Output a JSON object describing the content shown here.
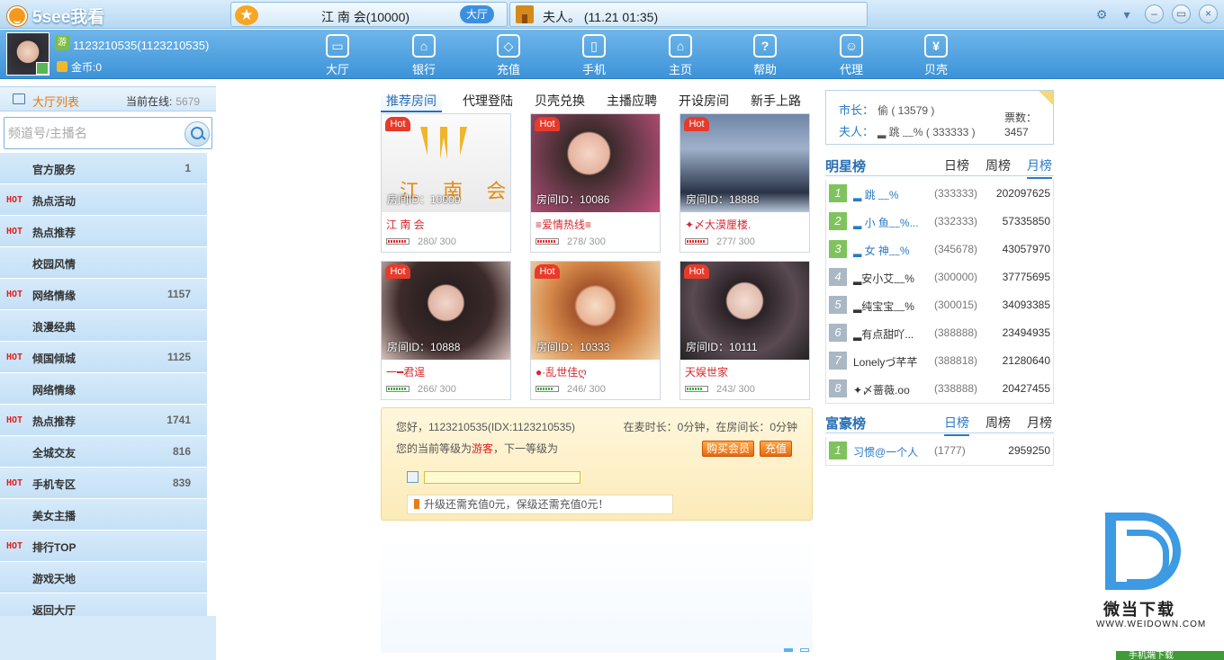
{
  "app": {
    "title": "5see我看"
  },
  "room_pill": {
    "name": "江 南 会(10000)",
    "badge": "大厅"
  },
  "notice": {
    "text": "夫人。 (11.21 01:35)"
  },
  "window_controls": {
    "settings": "⚙",
    "dropdown": "▾",
    "minimize": "–",
    "restore": "▭",
    "close": "×"
  },
  "user": {
    "badge": "游",
    "id_line": "1123210535(1123210535)",
    "coins": "金币:0"
  },
  "nav": [
    {
      "label": "大厅",
      "icon": "tv-icon",
      "glyph": "▭"
    },
    {
      "label": "银行",
      "icon": "bank-icon",
      "glyph": "⌂"
    },
    {
      "label": "充值",
      "icon": "diamond-icon",
      "glyph": "◇"
    },
    {
      "label": "手机",
      "icon": "phone-icon",
      "glyph": "▯"
    },
    {
      "label": "主页",
      "icon": "home-icon",
      "glyph": "⌂"
    },
    {
      "label": "帮助",
      "icon": "help-icon",
      "glyph": "?"
    },
    {
      "label": "代理",
      "icon": "agent-icon",
      "glyph": "☺"
    },
    {
      "label": "贝壳",
      "icon": "shell-icon",
      "glyph": "¥"
    }
  ],
  "sidebar": {
    "title": "大厅列表",
    "online_label": "当前在线:",
    "online_count": "5679",
    "search_placeholder": "频道号/主播名",
    "hot_label": "HOT",
    "items": [
      {
        "name": "官方服务",
        "count": "1",
        "hot": false
      },
      {
        "name": "热点活动",
        "count": "",
        "hot": true
      },
      {
        "name": "热点推荐",
        "count": "",
        "hot": true
      },
      {
        "name": "校园风情",
        "count": "",
        "hot": false
      },
      {
        "name": "网络情缘",
        "count": "1157",
        "hot": true
      },
      {
        "name": "浪漫经典",
        "count": "",
        "hot": false
      },
      {
        "name": "倾国倾城",
        "count": "1125",
        "hot": true
      },
      {
        "name": "网络情缘",
        "count": "",
        "hot": false
      },
      {
        "name": "热点推荐",
        "count": "1741",
        "hot": true
      },
      {
        "name": "全城交友",
        "count": "816",
        "hot": false
      },
      {
        "name": "手机专区",
        "count": "839",
        "hot": true
      },
      {
        "name": "美女主播",
        "count": "",
        "hot": false
      },
      {
        "name": "排行TOP",
        "count": "",
        "hot": true
      },
      {
        "name": "游戏天地",
        "count": "",
        "hot": false
      },
      {
        "name": "返回大厅",
        "count": "",
        "hot": false
      }
    ]
  },
  "tabs": [
    "推荐房间",
    "代理登陆",
    "贝壳兑换",
    "主播应聘",
    "开设房间",
    "新手上路"
  ],
  "rooms": [
    {
      "hot": "Hot",
      "logo_text": "江 南 会",
      "id": "房间ID：10000",
      "title": "江 南 会",
      "capacity": "280/ 300",
      "meter": "red",
      "fill": 0.93
    },
    {
      "hot": "Hot",
      "id": "房间ID：10086",
      "title": "≡爱情热线≡",
      "capacity": "278/ 300",
      "meter": "red",
      "fill": 0.93
    },
    {
      "hot": "Hot",
      "id": "房间ID：18888",
      "title": "✦〆大漠厘楼.",
      "capacity": "277/ 300",
      "meter": "red",
      "fill": 0.92
    },
    {
      "hot": "Hot",
      "id": "房间ID：10888",
      "title": "一━君逞",
      "capacity": "266/ 300",
      "meter": "green",
      "fill": 0.89
    },
    {
      "hot": "Hot",
      "id": "房间ID：10333",
      "title": "●·乱世佳ღ",
      "capacity": "246/ 300",
      "meter": "green",
      "fill": 0.82
    },
    {
      "hot": "Hot",
      "id": "房间ID：10111",
      "title": "天娱世家",
      "capacity": "243/ 300",
      "meter": "green",
      "fill": 0.81
    }
  ],
  "welcome": {
    "greeting": "您好，1123210535(IDX:1123210535)",
    "timers": "在麦时长：0分钟，在房间长：0分钟",
    "level_prefix": "您的当前等级为",
    "level_name": "游客",
    "level_suffix": "，下一等级为",
    "buy_vip": "购买会员",
    "recharge": "充值",
    "upgrade_text": "升级还需充值0元，保级还需充值0元！"
  },
  "mayor": {
    "mayor_label": "市长：",
    "mayor_value": "偷 ( 13579 )",
    "lady_label": "夫人：",
    "lady_value": "▂ 跳 ﹏% ( 333333 )",
    "votes_label": "票数：",
    "votes_value": "3457"
  },
  "star_rank": {
    "title": "明星榜",
    "tabs": [
      "日榜",
      "周榜",
      "月榜"
    ],
    "active_tab": 2,
    "rows": [
      {
        "rank": "1",
        "name": "▂ 跳 ﹏%",
        "id": "(333333)",
        "value": "202097625"
      },
      {
        "rank": "2",
        "name": "▂ 小 鱼﹏%...",
        "id": "(332333)",
        "value": "57335850"
      },
      {
        "rank": "3",
        "name": "▂ 女 神﹏%",
        "id": "(345678)",
        "value": "43057970"
      },
      {
        "rank": "4",
        "name": "▂安小艾﹏%",
        "id": "(300000)",
        "value": "37775695"
      },
      {
        "rank": "5",
        "name": "▂纯宝宝﹏%",
        "id": "(300015)",
        "value": "34093385"
      },
      {
        "rank": "6",
        "name": "▂有点甜吖...",
        "id": "(388888)",
        "value": "23494935"
      },
      {
        "rank": "7",
        "name": "Lonelyづ芊芊",
        "id": "(388818)",
        "value": "21280640"
      },
      {
        "rank": "8",
        "name": "✦〆蔷薇.oo",
        "id": "(338888)",
        "value": "20427455"
      }
    ]
  },
  "rich_rank": {
    "title": "富豪榜",
    "tabs": [
      "日榜",
      "周榜",
      "月榜"
    ],
    "active_tab": 0,
    "rows": [
      {
        "rank": "1",
        "name": "习惯@一个人",
        "id": "(1777)",
        "value": "2959250"
      }
    ]
  },
  "watermark": {
    "cn": "微当下载",
    "en": "WWW.WEIDOWN.COM"
  },
  "mobile_download": "手机端下载"
}
